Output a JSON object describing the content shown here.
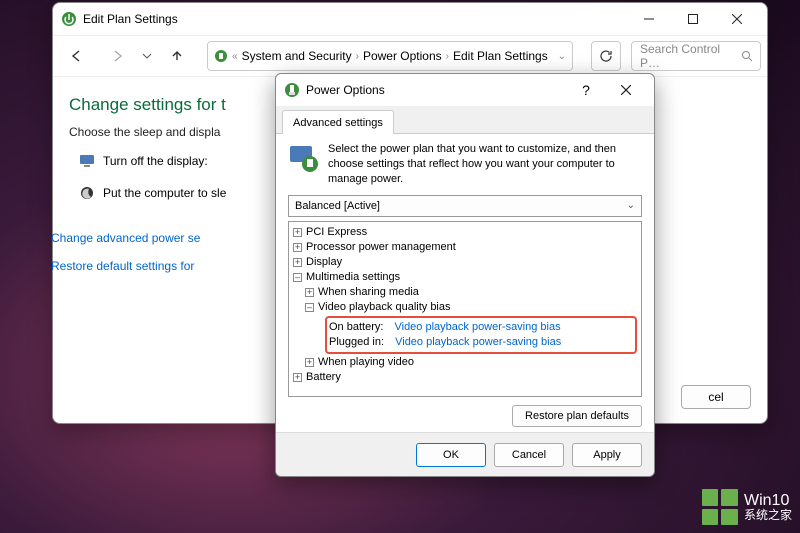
{
  "outer": {
    "title": "Edit Plan Settings",
    "breadcrumb": [
      "System and Security",
      "Power Options",
      "Edit Plan Settings"
    ],
    "search_placeholder": "Search Control P…",
    "heading": "Change settings for t",
    "subheading": "Choose the sleep and displa",
    "opt_display": "Turn off the display:",
    "opt_sleep": "Put the computer to sle",
    "link_advanced": "Change advanced power se",
    "link_restore": "Restore default settings for",
    "cancel": "cel"
  },
  "dialog": {
    "title": "Power Options",
    "tab": "Advanced settings",
    "intro": "Select the power plan that you want to customize, and then choose settings that reflect how you want your computer to manage power.",
    "plan": "Balanced [Active]",
    "tree": {
      "pci": "PCI Express",
      "ppm": "Processor power management",
      "display": "Display",
      "multimedia": "Multimedia settings",
      "sharing": "When sharing media",
      "vpqb": "Video playback quality bias",
      "on_batt_label": "On battery:",
      "on_batt_val": "Video playback power-saving bias",
      "plugged_label": "Plugged in:",
      "plugged_val": "Video playback power-saving bias",
      "playing": "When playing video",
      "battery": "Battery"
    },
    "restore": "Restore plan defaults",
    "ok": "OK",
    "cancel": "Cancel",
    "apply": "Apply"
  },
  "watermark": {
    "title": "Win10",
    "sub": "系统之家"
  }
}
